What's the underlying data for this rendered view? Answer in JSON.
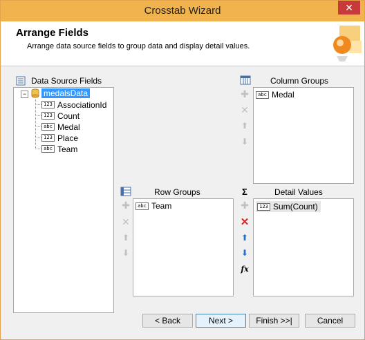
{
  "window": {
    "title": "Crosstab Wizard",
    "close_symbol": "✕"
  },
  "header": {
    "title": "Arrange Fields",
    "description": "Arrange data source fields to group data and display detail values."
  },
  "data_source": {
    "label": "Data Source Fields",
    "root": "medalsData",
    "expander": "−",
    "fields": [
      {
        "type": "123",
        "name": "AssociationId"
      },
      {
        "type": "123",
        "name": "Count"
      },
      {
        "type": "abc",
        "name": "Medal"
      },
      {
        "type": "123",
        "name": "Place"
      },
      {
        "type": "abc",
        "name": "Team"
      }
    ]
  },
  "column_groups": {
    "label": "Column Groups",
    "items": [
      {
        "type": "abc",
        "name": "Medal"
      }
    ]
  },
  "row_groups": {
    "label": "Row Groups",
    "items": [
      {
        "type": "abc",
        "name": "Team"
      }
    ]
  },
  "detail_values": {
    "label": "Detail Values",
    "sigma": "Σ",
    "fx": "fx",
    "items": [
      {
        "type": "123",
        "name": "Sum(Count)"
      }
    ]
  },
  "symbols": {
    "add": "✚",
    "remove": "✕",
    "up": "⬆",
    "down": "⬇"
  },
  "buttons": {
    "back": "< Back",
    "next": "Next >",
    "finish": "Finish >>|",
    "cancel": "Cancel"
  },
  "colors": {
    "titlebar": "#f0b34d",
    "close": "#c8393a",
    "accent": "#1e6fd6",
    "remove_red": "#e02020"
  }
}
